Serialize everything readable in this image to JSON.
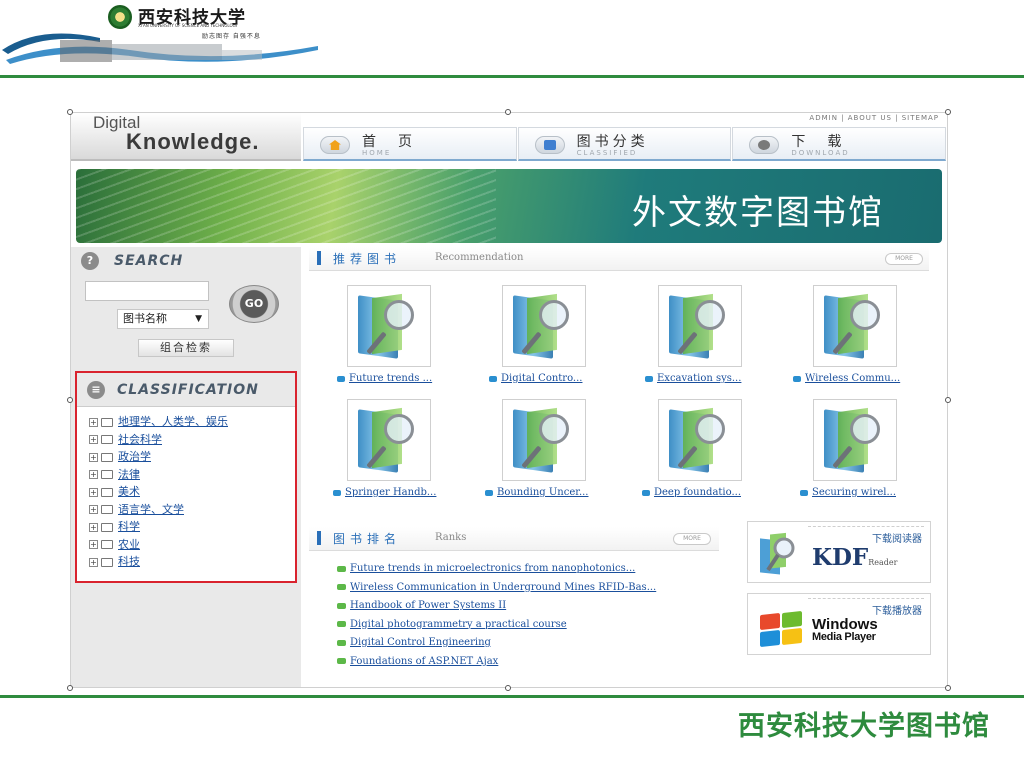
{
  "slide": {
    "logo": {
      "name": "西安科技大学",
      "english": "XI'AN UNIVERSITY OF SCIENCE AND TECHNOLOGY",
      "motto": "励志图存   自强不息"
    },
    "footer_title": "西安科技大学图书馆"
  },
  "site": {
    "brand": {
      "line1": "Digital",
      "line2": "Knowledge."
    },
    "top_links": [
      "ADMIN",
      "ABOUT US",
      "SITEMAP"
    ],
    "nav": [
      {
        "label": "首　页",
        "sub": "HOME",
        "icon": "home-icon",
        "color": "#f0a21a"
      },
      {
        "label": "图书分类",
        "sub": "CLASSIFIED",
        "icon": "book-category-icon",
        "color": "#3f7fd0"
      },
      {
        "label": "下　载",
        "sub": "DOWNLOAD",
        "icon": "download-icon",
        "color": "#7a7a7a"
      }
    ],
    "banner_title": "外文数字图书馆",
    "search": {
      "title": "SEARCH",
      "input_value": "",
      "go_label": "GO",
      "select_value": "图书名称",
      "combo_label": "组合检索"
    },
    "classification": {
      "title": "CLASSIFICATION",
      "items": [
        "地理学、人类学、娱乐",
        "社会科学",
        "政治学",
        "法律",
        "美术",
        "语言学、文学",
        "科学",
        "农业",
        "科技"
      ]
    },
    "recommendation": {
      "title": "推荐图书",
      "subtitle": "Recommendation",
      "more": "MORE",
      "books": [
        "Future trends ...",
        "Digital Contro...",
        "Excavation sys...",
        "Wireless Commu...",
        "Springer Handb...",
        "Bounding Uncer...",
        "Deep foundatio...",
        "Securing wirel..."
      ]
    },
    "ranks": {
      "title": "图书排名",
      "subtitle": "Ranks",
      "more": "MORE",
      "items": [
        "Future trends in microelectronics from nanophotonics...",
        "Wireless Communication in Underground Mines RFID-Bas...",
        "Handbook of Power Systems II",
        "Digital photogrammetry a practical course",
        "Digital Control Engineering",
        "Foundations of ASP.NET Ajax"
      ]
    },
    "downloads": [
      {
        "label": "下载阅读器",
        "product": "KDF",
        "product_sub": "Reader"
      },
      {
        "label": "下载播放器",
        "product": "Windows",
        "product_sub": "Media Player"
      }
    ],
    "colors": {
      "accent_green": "#2e8b3e",
      "link_blue": "#1a4f9c",
      "highlight_red": "#d9232e"
    }
  }
}
